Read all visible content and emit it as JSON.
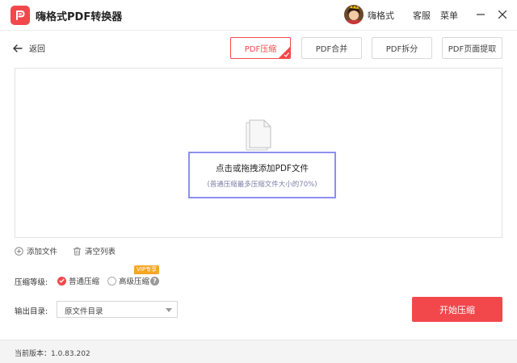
{
  "app": {
    "title": "嗨格式PDF转换器",
    "username": "嗨格式",
    "service_label": "客服",
    "menu_label": "菜单",
    "brand_color": "#f2484b"
  },
  "toolbar": {
    "back_label": "返回",
    "tabs": [
      {
        "label": "PDF压缩",
        "active": true
      },
      {
        "label": "PDF合并",
        "active": false
      },
      {
        "label": "PDF拆分",
        "active": false
      },
      {
        "label": "PDF页面提取",
        "active": false
      }
    ]
  },
  "dropzone": {
    "title": "点击或拖拽添加PDF文件",
    "hint": "(普通压缩最多压缩文件大小的70%)"
  },
  "actions": {
    "add_file": "添加文件",
    "clear_list": "清空列表"
  },
  "compression": {
    "label": "压缩等级:",
    "options": [
      {
        "label": "普通压缩",
        "checked": true
      },
      {
        "label": "高级压缩",
        "checked": false
      }
    ],
    "vip_badge": "VIP专享"
  },
  "output": {
    "label": "输出目录:",
    "selected": "原文件目录"
  },
  "start_button": "开始压缩",
  "footer": {
    "version": "当前版本：1.0.83.202"
  }
}
